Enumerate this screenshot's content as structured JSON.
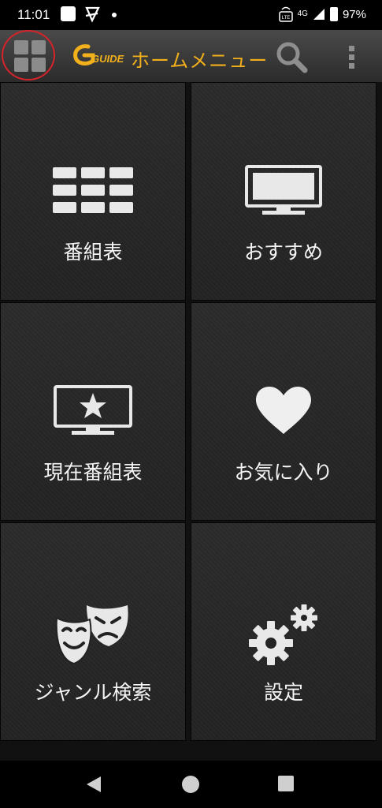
{
  "status_bar": {
    "time": "11:01",
    "network": "4G",
    "volte": "VoLTE",
    "battery": "97%",
    "icons": [
      "notification-square-icon",
      "app-notification-icon",
      "dot-icon",
      "volte-icon",
      "signal-icon",
      "battery-icon"
    ]
  },
  "toolbar": {
    "logo": "G GUIDE",
    "title": "ホームメニュー",
    "title_color": "#f2b11c",
    "icons": [
      "grid-menu-icon",
      "search-icon",
      "more-vert-icon"
    ]
  },
  "tiles": [
    {
      "label": "番組表",
      "icon": "tv-schedule-icon"
    },
    {
      "label": "おすすめ",
      "icon": "tv-icon"
    },
    {
      "label": "現在番組表",
      "icon": "tv-star-icon"
    },
    {
      "label": "お気に入り",
      "icon": "heart-icon"
    },
    {
      "label": "ジャンル検索",
      "icon": "theater-masks-icon"
    },
    {
      "label": "設定",
      "icon": "gears-icon"
    }
  ],
  "nav_bar": {
    "icons": [
      "back-icon",
      "home-icon",
      "recents-icon"
    ]
  },
  "colors": {
    "accent": "#f2b11c",
    "highlight_ring": "#d8232a",
    "tile_bg": "#262626"
  }
}
